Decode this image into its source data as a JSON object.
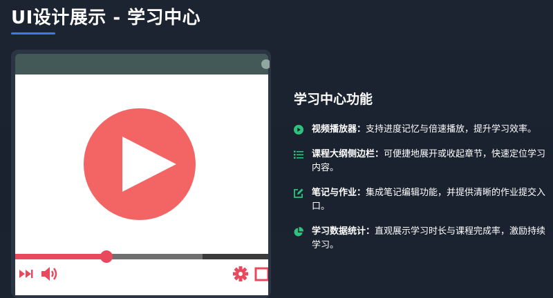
{
  "page": {
    "title": "UI设计展示 - 学习中心"
  },
  "player": {
    "progress_fraction": 0.36,
    "buffered_fraction": 0.74,
    "controls": {
      "left": [
        "fast-forward-icon",
        "volume-icon"
      ],
      "right": [
        "gear-icon",
        "fullscreen-icon"
      ]
    },
    "colors": {
      "play_button": "#f36464",
      "progress": "#e8495d",
      "header": "#435957"
    }
  },
  "features": {
    "title": "学习中心功能",
    "items": [
      {
        "icon": "play-circle-icon",
        "label": "视频播放器：",
        "text": "支持进度记忆与倍速播放，提升学习效率。"
      },
      {
        "icon": "list-icon",
        "label": "课程大纲侧边栏：",
        "text": "可便捷地展开或收起章节，快速定位学习内容。"
      },
      {
        "icon": "edit-icon",
        "label": "笔记与作业：",
        "text": "集成笔记编辑功能，并提供清晰的作业提交入口。"
      },
      {
        "icon": "pie-chart-icon",
        "label": "学习数据统计：",
        "text": "直观展示学习时长与课程完成率，激励持续学习。"
      }
    ],
    "icon_color": "#2ec27e"
  }
}
